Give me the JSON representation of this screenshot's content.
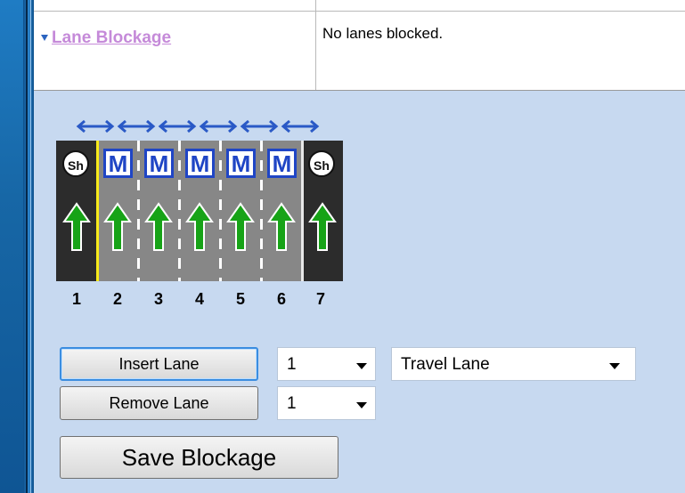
{
  "lane_blockage": {
    "link_label": "Lane Blockage",
    "status_text": "No lanes blocked."
  },
  "diagram": {
    "lanes": [
      {
        "number": "1",
        "type_label": "Sh"
      },
      {
        "number": "2",
        "type_label": "M"
      },
      {
        "number": "3",
        "type_label": "M"
      },
      {
        "number": "4",
        "type_label": "M"
      },
      {
        "number": "5",
        "type_label": "M"
      },
      {
        "number": "6",
        "type_label": "M"
      },
      {
        "number": "7",
        "type_label": "Sh"
      }
    ],
    "colors": {
      "shoulder": "#2c2c2c",
      "travel_lane": "#878787",
      "edge_line": "#f7ea1a",
      "arrow": "#17a317",
      "managed_badge": "#1f45c5"
    },
    "icons": {
      "lane_arrow": "up-arrow-icon",
      "shift_arrow": "double-arrow-icon"
    }
  },
  "controls": {
    "insert_label": "Insert Lane",
    "insert_position": "1",
    "lane_type": "Travel Lane",
    "remove_label": "Remove Lane",
    "remove_position": "1",
    "save_label": "Save Blockage"
  }
}
